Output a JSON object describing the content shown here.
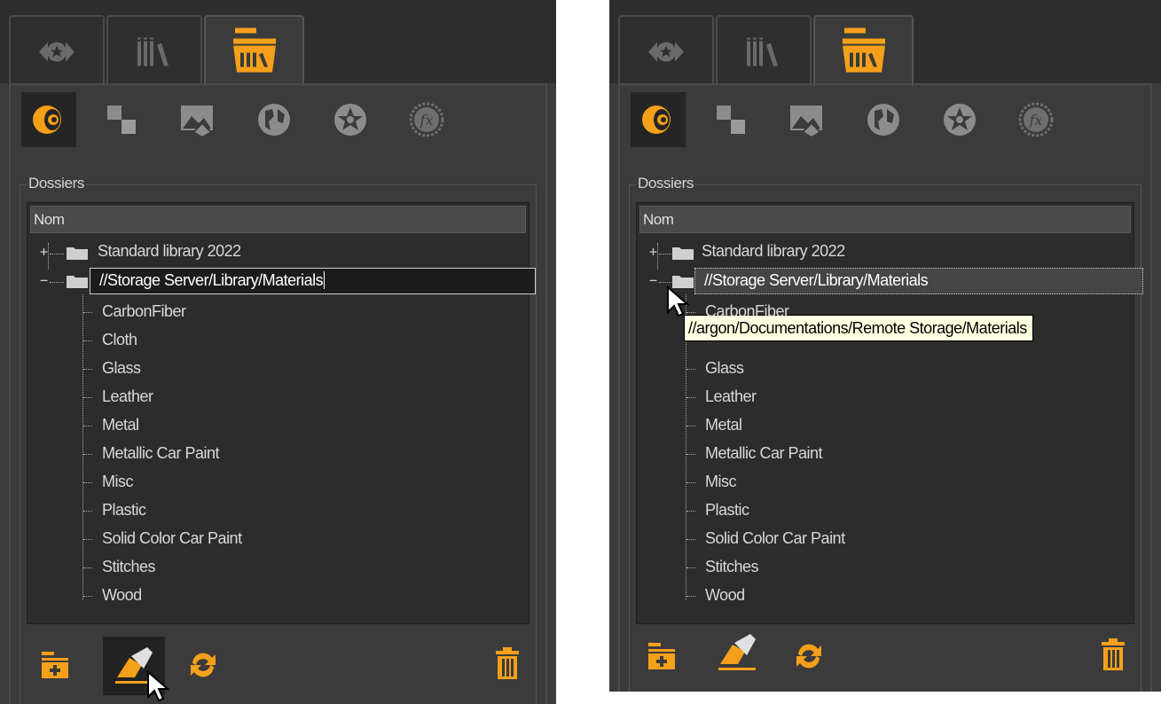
{
  "colors": {
    "accent": "#f5a01a",
    "panel": "#3b3b3b",
    "tree_bg": "#2c2c2c",
    "tooltip_bg": "#ffffe1"
  },
  "tabs": [
    {
      "icon": "material-tab-icon"
    },
    {
      "icon": "library-tab-icon"
    },
    {
      "icon": "library-folder-tab-icon",
      "active": true
    }
  ],
  "type_icons": [
    "material-icon",
    "texture-icon",
    "backplate-icon",
    "environment-icon",
    "light-icon",
    "fx-icon"
  ],
  "group_title": "Dossiers",
  "tree": {
    "header": "Nom",
    "root_items": [
      {
        "label": "Standard library 2022",
        "expander": "+"
      },
      {
        "label": "//Storage Server/Library/Materials",
        "expander": "−"
      }
    ],
    "children": [
      "CarbonFiber",
      "Cloth",
      "Glass",
      "Leather",
      "Metal",
      "Metallic Car Paint",
      "Misc",
      "Plastic",
      "Solid Color Car Paint",
      "Stitches",
      "Wood"
    ]
  },
  "left_panel": {
    "editing_value": "//Storage Server/Library/Materials"
  },
  "right_panel": {
    "tooltip": "//argon/Documentations/Remote Storage/Materials"
  },
  "bottom_buttons": [
    "add-folder-icon",
    "edit-path-icon",
    "refresh-icon",
    "delete-icon"
  ]
}
